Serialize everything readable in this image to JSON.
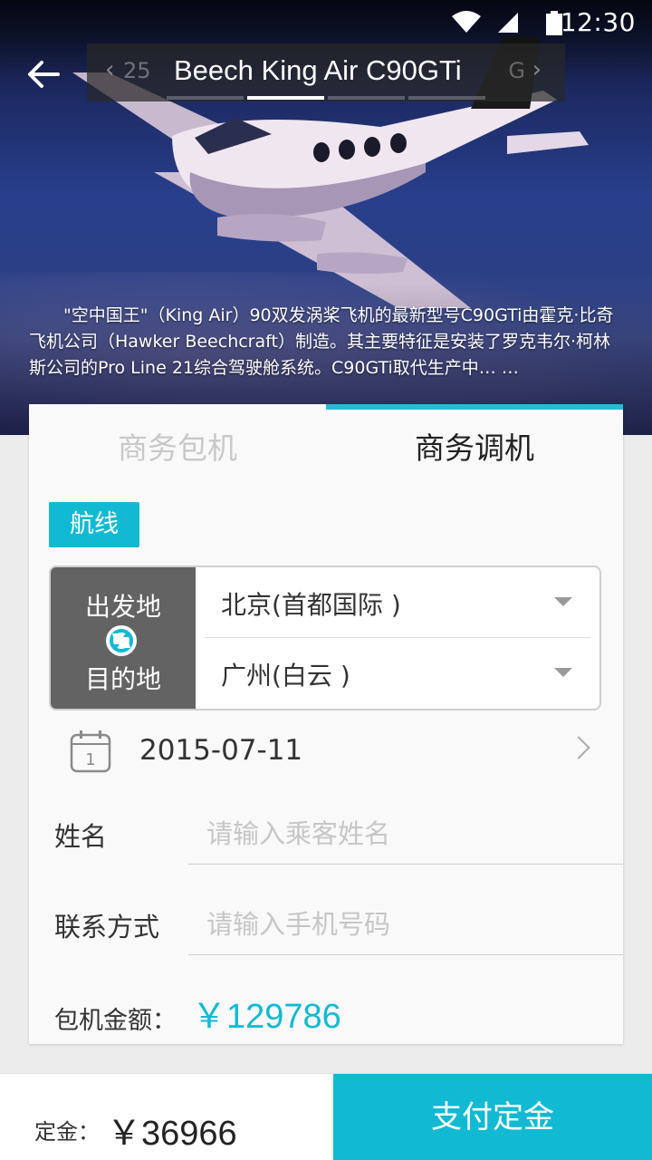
{
  "status_bar": {
    "time": "12:30"
  },
  "header": {
    "title": "Beech King Air C90GTi",
    "prev_hint": "25",
    "next_hint": "G",
    "indicator_count": 4,
    "active_indicator": 1
  },
  "hero": {
    "description": "\"空中国王\"（King Air）90双发涡桨飞机的最新型号C90GTi由霍克·比奇飞机公司（Hawker Beechcraft）制造。其主要特征是安装了罗克韦尔·柯林斯公司的Pro Line 21综合驾驶舱系统。C90GTi取代生产中… …"
  },
  "tabs": [
    {
      "label": "商务包机",
      "active": false
    },
    {
      "label": "商务调机",
      "active": true
    }
  ],
  "route": {
    "badge": "航线",
    "from_label": "出发地",
    "to_label": "目的地",
    "from_value": "北京(首都国际 )",
    "to_value": "广州(白云 )"
  },
  "date": {
    "value": "2015-07-11",
    "calendar_day": "1"
  },
  "form": {
    "name_label": "姓名",
    "name_placeholder": "请输入乘客姓名",
    "phone_label": "联系方式",
    "phone_placeholder": "请输入手机号码"
  },
  "amount": {
    "label": "包机金额：",
    "value": "￥129786"
  },
  "bottom": {
    "deposit_label": "定金：",
    "deposit_value": "￥36966",
    "pay_button": "支付定金"
  },
  "colors": {
    "accent": "#11bad2",
    "route_left_bg": "#636363"
  },
  "icons": [
    "back-arrow-icon",
    "wifi-icon",
    "signal-icon",
    "battery-icon",
    "swap-icon",
    "calendar-icon",
    "chevron-right-icon",
    "dropdown-arrow-icon"
  ]
}
